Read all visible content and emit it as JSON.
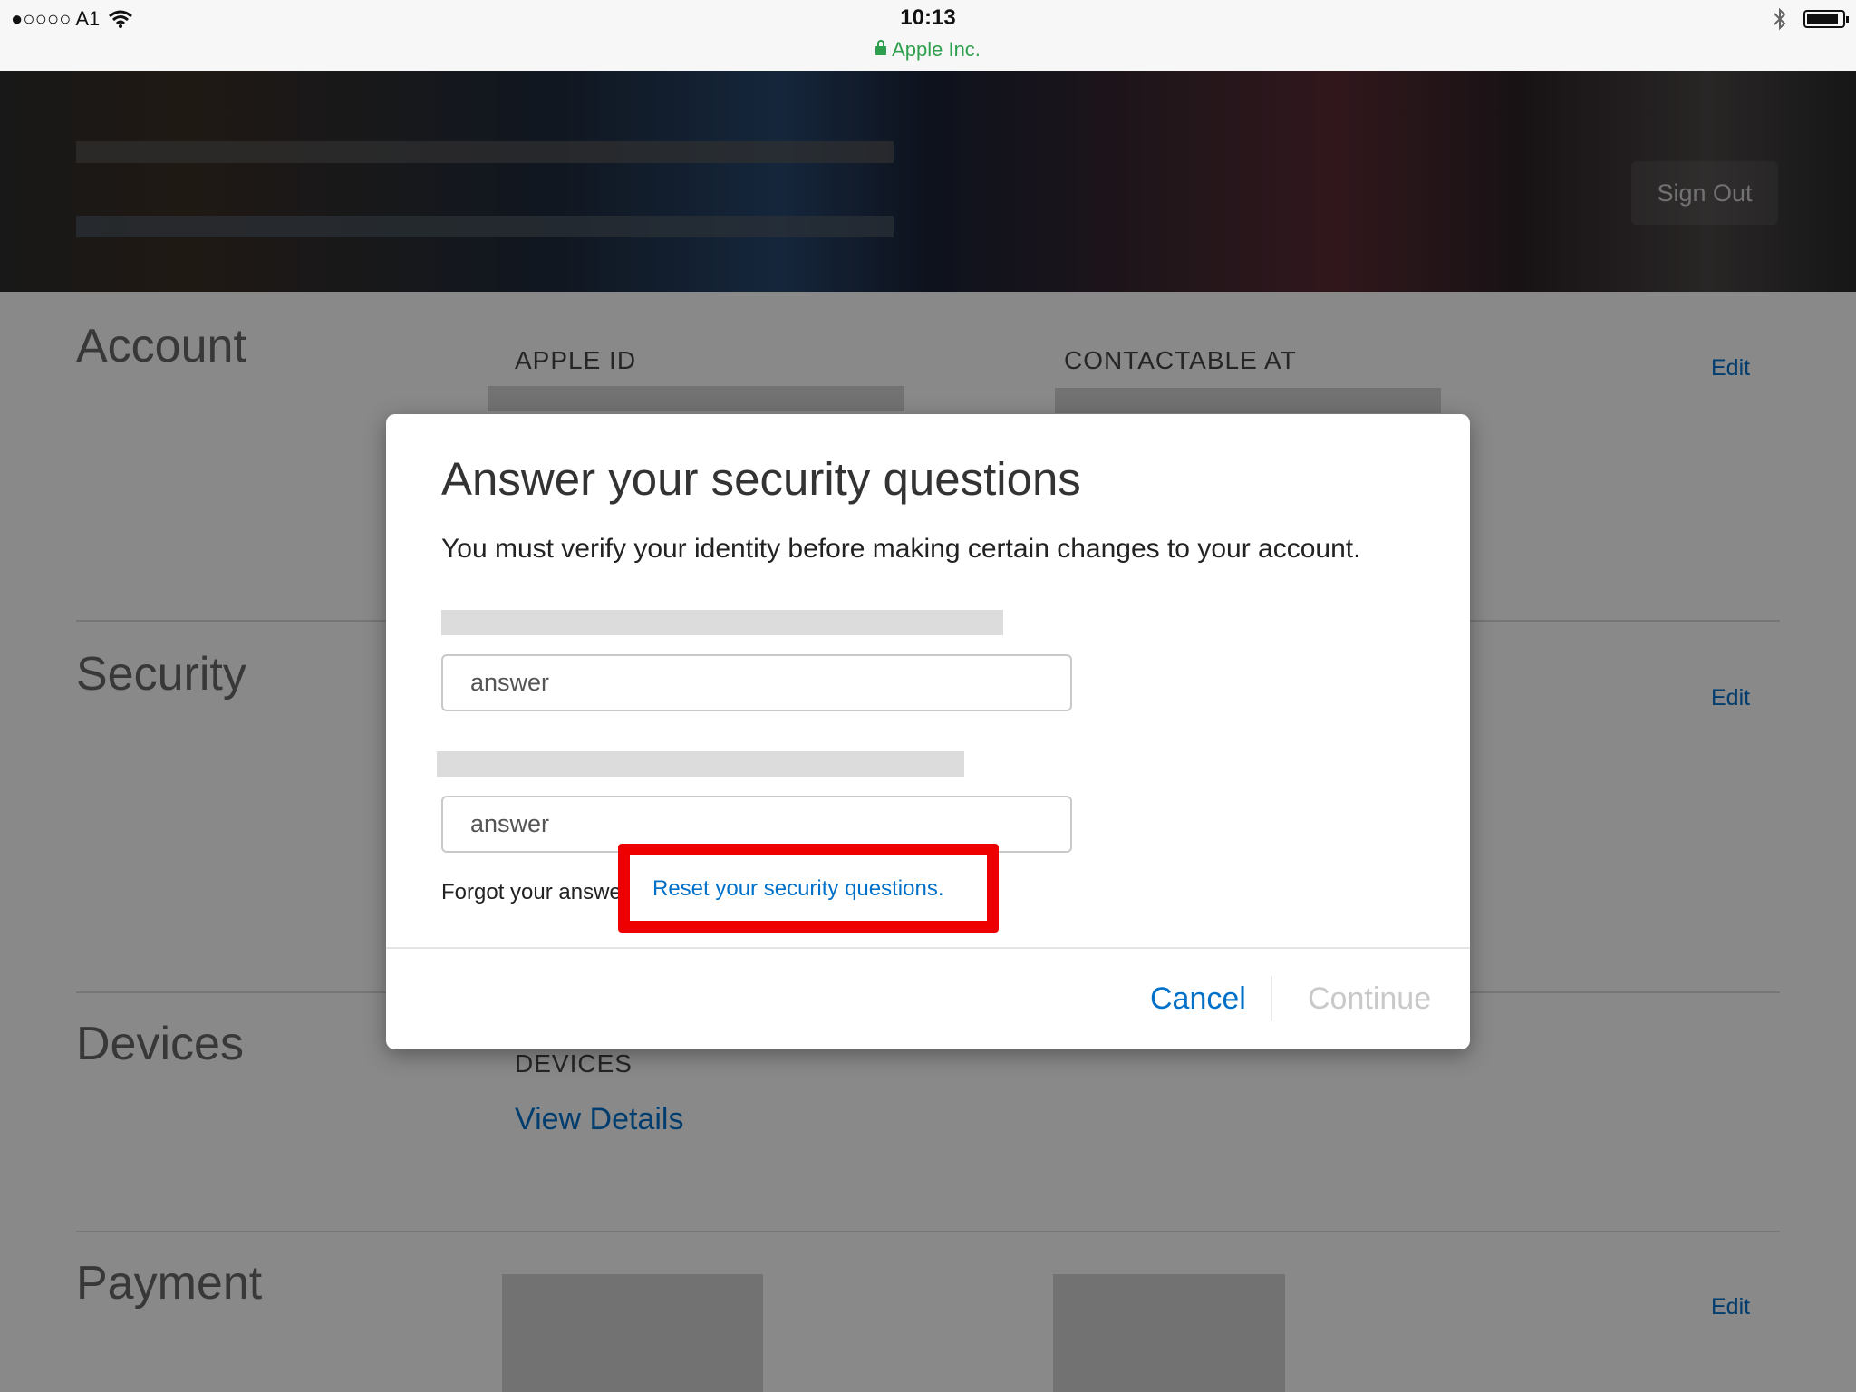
{
  "status_bar": {
    "carrier": "●○○○○ A1",
    "wifi_icon": "wifi-icon",
    "time": "10:13",
    "site": "Apple Inc.",
    "bluetooth_icon": "bluetooth-icon",
    "battery_icon": "battery-icon"
  },
  "header": {
    "sign_out": "Sign Out"
  },
  "sections": {
    "account": {
      "title": "Account",
      "apple_id_label": "APPLE ID",
      "contactable_label": "CONTACTABLE AT",
      "edit": "Edit"
    },
    "security": {
      "title": "Security",
      "edit": "Edit"
    },
    "devices": {
      "title": "Devices",
      "label": "DEVICES",
      "view_details": "View Details"
    },
    "payment": {
      "title": "Payment",
      "edit": "Edit"
    }
  },
  "modal": {
    "title": "Answer your security questions",
    "subtitle": "You must verify your identity before making certain changes to your account.",
    "answer1_placeholder": "answer",
    "answer2_placeholder": "answer",
    "forgot_text": "Forgot your answers?",
    "reset_link": "Reset your security questions.",
    "cancel": "Cancel",
    "continue": "Continue"
  },
  "colors": {
    "link": "#0070c9",
    "highlight": "#ee0000",
    "secure_green": "#2e9f4d"
  }
}
